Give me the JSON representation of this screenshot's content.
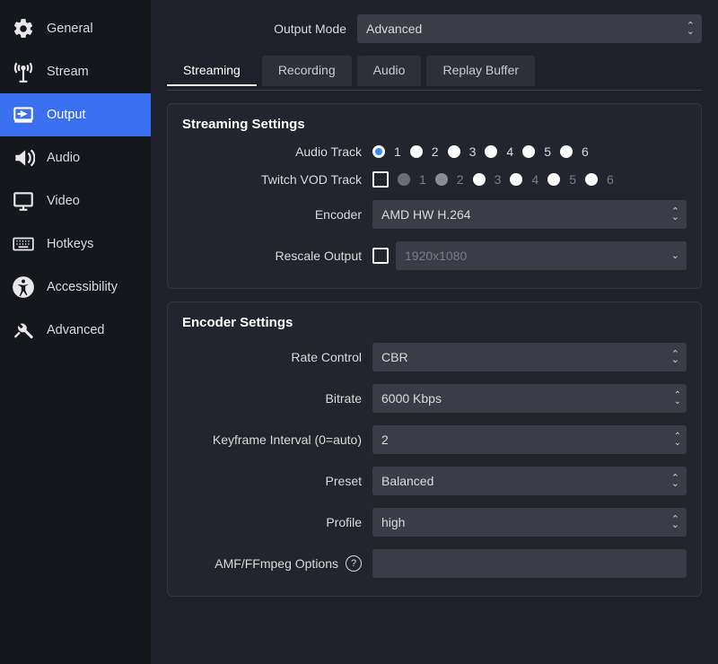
{
  "sidebar": {
    "items": [
      {
        "label": "General"
      },
      {
        "label": "Stream"
      },
      {
        "label": "Output"
      },
      {
        "label": "Audio"
      },
      {
        "label": "Video"
      },
      {
        "label": "Hotkeys"
      },
      {
        "label": "Accessibility"
      },
      {
        "label": "Advanced"
      }
    ]
  },
  "outputMode": {
    "label": "Output Mode",
    "value": "Advanced"
  },
  "tabs": [
    {
      "label": "Streaming"
    },
    {
      "label": "Recording"
    },
    {
      "label": "Audio"
    },
    {
      "label": "Replay Buffer"
    }
  ],
  "streamingSettings": {
    "title": "Streaming Settings",
    "audioTrack": {
      "label": "Audio Track",
      "options": [
        "1",
        "2",
        "3",
        "4",
        "5",
        "6"
      ],
      "selected": "1"
    },
    "twitchVod": {
      "label": "Twitch VOD Track",
      "checked": false,
      "options": [
        "1",
        "2",
        "3",
        "4",
        "5",
        "6"
      ],
      "selected": "2"
    },
    "encoder": {
      "label": "Encoder",
      "value": "AMD HW H.264"
    },
    "rescale": {
      "label": "Rescale Output",
      "checked": false,
      "value": "1920x1080"
    }
  },
  "encoderSettings": {
    "title": "Encoder Settings",
    "rateControl": {
      "label": "Rate Control",
      "value": "CBR"
    },
    "bitrate": {
      "label": "Bitrate",
      "value": "6000 Kbps"
    },
    "keyframe": {
      "label": "Keyframe Interval (0=auto)",
      "value": "2"
    },
    "preset": {
      "label": "Preset",
      "value": "Balanced"
    },
    "profile": {
      "label": "Profile",
      "value": "high"
    },
    "amf": {
      "label": "AMF/FFmpeg Options",
      "value": ""
    }
  }
}
